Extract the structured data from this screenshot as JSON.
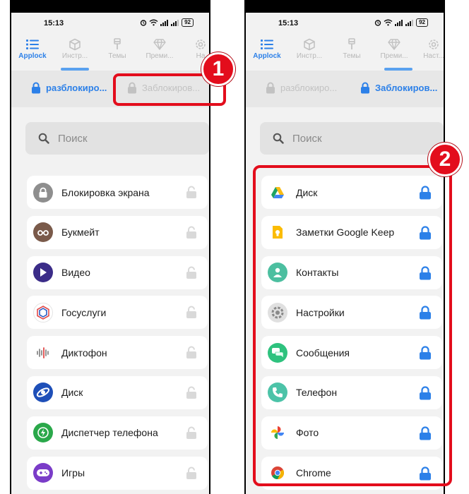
{
  "colors": {
    "accent": "#2c80e8",
    "callout": "#e30d1c",
    "inactive": "#c2c2c2"
  },
  "status_bar": {
    "time": "15:13",
    "battery": "92"
  },
  "tabs": [
    {
      "label": "Applock",
      "icon": "list-icon",
      "active": true
    },
    {
      "label": "Инстр...",
      "icon": "cube-icon",
      "active": false
    },
    {
      "label": "Темы",
      "icon": "brush-icon",
      "active": false
    },
    {
      "label": "Преми...",
      "icon": "diamond-icon",
      "active": false
    },
    {
      "label": "Наст...",
      "icon": "gear-icon",
      "active": false
    }
  ],
  "tabs_left_last_label": "На",
  "segment": {
    "unlocked_label": "разблокиро...",
    "locked_label": "Заблокиров..."
  },
  "search": {
    "placeholder": "Поиск"
  },
  "left_list": [
    {
      "name": "Блокировка экрана",
      "icon": "screen-lock-icon",
      "icon_color": "#8e8e8e"
    },
    {
      "name": "Букмейт",
      "icon": "bookmate-icon",
      "icon_color": "#7a5a4a"
    },
    {
      "name": "Видео",
      "icon": "play-icon",
      "icon_color": "#3b2c88"
    },
    {
      "name": "Госуслуги",
      "icon": "gosuslugi-icon",
      "icon_color": "#ffffff"
    },
    {
      "name": "Диктофон",
      "icon": "waveform-icon",
      "icon_color": "#ffffff"
    },
    {
      "name": "Диск",
      "icon": "disk-icon",
      "icon_color": "#1e4fb8"
    },
    {
      "name": "Диспетчер телефона",
      "icon": "bolt-shield-icon",
      "icon_color": "#2aa84a"
    },
    {
      "name": "Игры",
      "icon": "gamepad-icon",
      "icon_color": "#7a3cc8"
    }
  ],
  "right_list": [
    {
      "name": "Диск",
      "icon": "google-drive-icon",
      "icon_color": "#ffffff"
    },
    {
      "name": "Заметки Google Keep",
      "icon": "keep-icon",
      "icon_color": "#ffffff"
    },
    {
      "name": "Контакты",
      "icon": "contacts-icon",
      "icon_color": "#4cbfa0"
    },
    {
      "name": "Настройки",
      "icon": "settings-icon",
      "icon_color": "#e0e0e0"
    },
    {
      "name": "Сообщения",
      "icon": "messages-icon",
      "icon_color": "#2ec27e"
    },
    {
      "name": "Телефон",
      "icon": "phone-icon",
      "icon_color": "#4cc3a8"
    },
    {
      "name": "Фото",
      "icon": "photos-icon",
      "icon_color": "#ffffff"
    },
    {
      "name": "Chrome",
      "icon": "chrome-icon",
      "icon_color": "#ffffff"
    }
  ],
  "callouts": {
    "first": "1",
    "second": "2"
  }
}
